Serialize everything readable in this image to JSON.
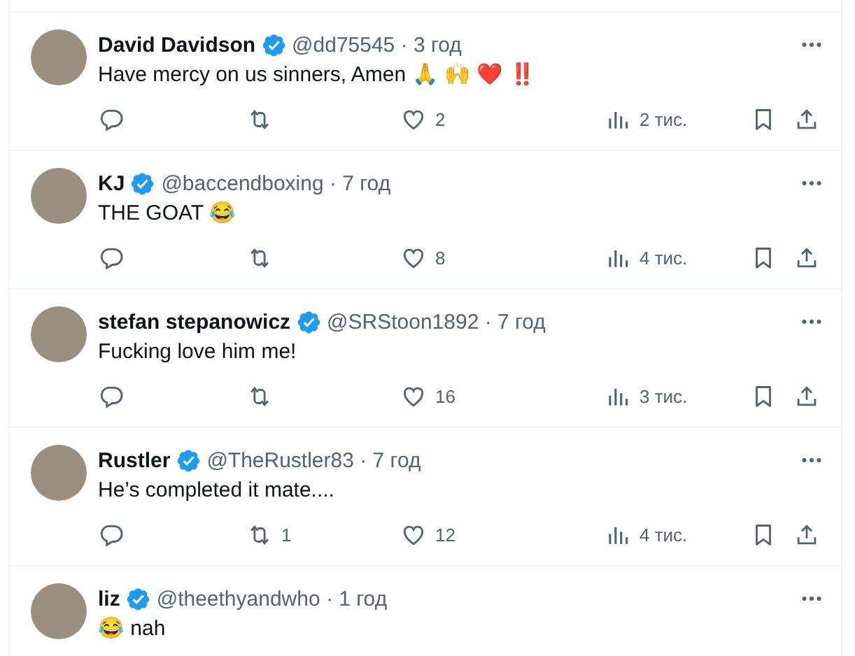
{
  "replies": [
    {
      "name": "David Davidson",
      "verified": true,
      "meta": "@dd75545 · 3 год",
      "text": "Have mercy on us sinners, Amen 🙏 🙌 ❤️ ‼️",
      "likes": "2",
      "views": "2 тис."
    },
    {
      "name": "KJ",
      "verified": true,
      "meta": "@baccendboxing · 7 год",
      "text": "THE GOAT 😂",
      "likes": "8",
      "views": "4 тис."
    },
    {
      "name": "stefan stepanowicz",
      "verified": true,
      "meta": "@SRStoon1892 · 7 год",
      "text": "Fucking love him me!",
      "likes": "16",
      "views": "3 тис."
    },
    {
      "name": "Rustler",
      "verified": true,
      "meta": "@TheRustler83 · 7 год",
      "text": "He’s completed it mate....",
      "retweets": "1",
      "likes": "12",
      "views": "4 тис."
    },
    {
      "name": "liz",
      "verified": true,
      "meta": "@theethyandwho · 1 год",
      "text": "😂 nah"
    }
  ]
}
